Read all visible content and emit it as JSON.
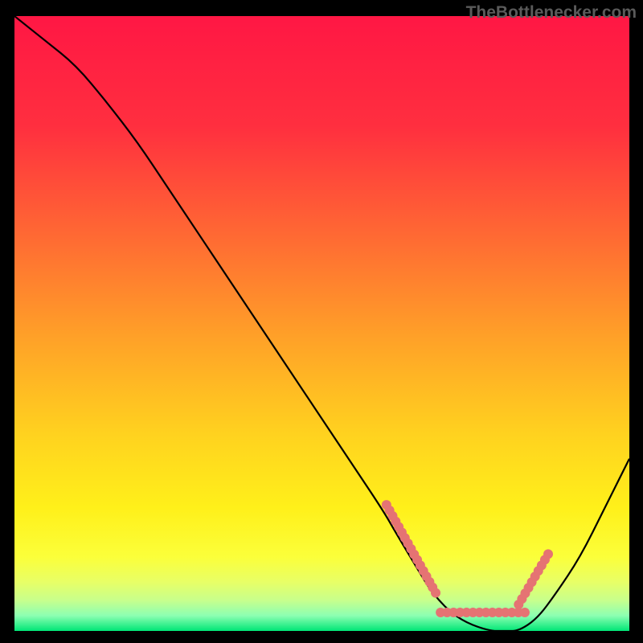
{
  "watermark": "TheBottlenecker.com",
  "chart_data": {
    "type": "line",
    "title": "",
    "xlabel": "",
    "ylabel": "",
    "xlim": [
      0,
      100
    ],
    "ylim": [
      0,
      100
    ],
    "gradient_stops": [
      {
        "offset": 0,
        "color": "#ff1744"
      },
      {
        "offset": 18,
        "color": "#ff2f3f"
      },
      {
        "offset": 36,
        "color": "#ff6a33"
      },
      {
        "offset": 52,
        "color": "#ffa028"
      },
      {
        "offset": 68,
        "color": "#ffd21f"
      },
      {
        "offset": 80,
        "color": "#fff01a"
      },
      {
        "offset": 88,
        "color": "#fbff3a"
      },
      {
        "offset": 92,
        "color": "#e8ff66"
      },
      {
        "offset": 95,
        "color": "#c8ff8c"
      },
      {
        "offset": 97.5,
        "color": "#8cffb2"
      },
      {
        "offset": 100,
        "color": "#00e676"
      }
    ],
    "curve": {
      "x": [
        0,
        5,
        10,
        15,
        20,
        25,
        30,
        35,
        40,
        45,
        50,
        55,
        60,
        62,
        65,
        68,
        72,
        77,
        80,
        82,
        85,
        88,
        92,
        96,
        100
      ],
      "y": [
        100,
        96,
        92,
        86,
        79.5,
        72,
        64.5,
        57,
        49.5,
        42,
        34.5,
        27,
        19.5,
        16,
        11,
        6,
        2,
        0,
        0,
        0,
        2,
        6,
        12,
        20,
        28
      ]
    },
    "marker_band": {
      "segments": [
        {
          "x_pct": [
            60.5,
            68.5
          ],
          "y_pct": [
            20.5,
            6.2
          ]
        },
        {
          "x_pct": [
            69.3,
            83.0
          ],
          "y_pct": [
            3.0,
            3.0
          ]
        },
        {
          "x_pct": [
            82.0,
            86.8
          ],
          "y_pct": [
            4.3,
            12.5
          ]
        }
      ],
      "color": "#e57373",
      "radius_px": 6.0,
      "spacing_px": 8.0
    }
  }
}
